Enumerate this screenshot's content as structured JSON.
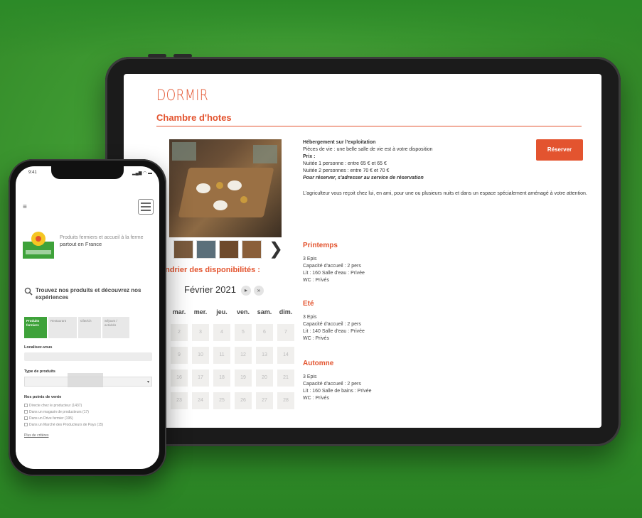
{
  "tablet": {
    "title": "DORMIR",
    "subtitle": "Chambre d'hotes",
    "reserve_button": "Réserver",
    "info_lines": [
      {
        "text": "Hébergement sur l'exploitation",
        "style": "bold"
      },
      {
        "text": "Pièces de vie : une belle salle de vie est à votre disposition",
        "style": "bold-lead"
      },
      {
        "text": "Prix :",
        "style": "bold"
      },
      {
        "text": "Nuitée 1 personne : entre 65 € et 65 €",
        "style": "normal"
      },
      {
        "text": "Nuitée 2 personnes : entre 70 € et 70 €",
        "style": "normal"
      },
      {
        "text": "Pour réserver, s'adresser au service de réservation",
        "style": "bold-italic"
      }
    ],
    "description": "L'agriculteur vous reçoit chez lui, en ami, pour une ou plusieurs nuits et dans un espace spécialement aménagé à votre attention.",
    "seasons": [
      {
        "name": "Printemps",
        "lines": [
          "3 Epis",
          "Capacité d'accueil : 2 pers",
          "Lit : 160 Salle d'eau : Privée",
          "WC : Privés"
        ]
      },
      {
        "name": "Eté",
        "lines": [
          "3 Epis",
          "Capacité d'accueil : 2 pers",
          "Lit : 140 Salle d'eau : Privée",
          "WC : Privés"
        ]
      },
      {
        "name": "Automne",
        "lines": [
          "3 Epis",
          "Capacité d'accueil : 2 pers",
          "Lit : 160 Salle de bains : Privée",
          "WC : Privés"
        ]
      }
    ],
    "calendar": {
      "title": "endrier des disponibilités :",
      "month": "Février 2021",
      "next": "▸",
      "next2": "»",
      "weekdays": [
        "mar.",
        "mer.",
        "jeu.",
        "ven.",
        "sam.",
        "dim."
      ],
      "rows": [
        [
          "2",
          "3",
          "4",
          "5",
          "6",
          "7"
        ],
        [
          "9",
          "10",
          "11",
          "12",
          "13",
          "14"
        ],
        [
          "16",
          "17",
          "18",
          "19",
          "20",
          "21"
        ],
        [
          "23",
          "24",
          "25",
          "26",
          "27",
          "28"
        ]
      ]
    },
    "thumb_next": "❯"
  },
  "phone": {
    "time": "9:41",
    "status": "▂▄▆ ◠ ▬",
    "tagline": "Produits fermiers et accueil à la ferme",
    "tagline_strong": "partout en France",
    "search_title": "Trouvez nos produits et découvrez nos expériences",
    "tabs": [
      "Produits fermiers",
      "Restaurant",
      "Gîte/Ch",
      "Séjours / activités"
    ],
    "localisation_label": "Localisez-vous",
    "product_type_label": "Type de produits",
    "points_label": "Nos points de vente",
    "checkboxes": [
      "Directe chez le producteur (1437)",
      "Dans un magasin de producteurs (17)",
      "Dans un Drive fermier (195)",
      "Dans un Marché des Producteurs de Pays (15)"
    ],
    "more_link": "Plus de critères",
    "caret": "▾"
  },
  "colors": {
    "accent": "#e3542f",
    "green": "#3ea23a"
  }
}
